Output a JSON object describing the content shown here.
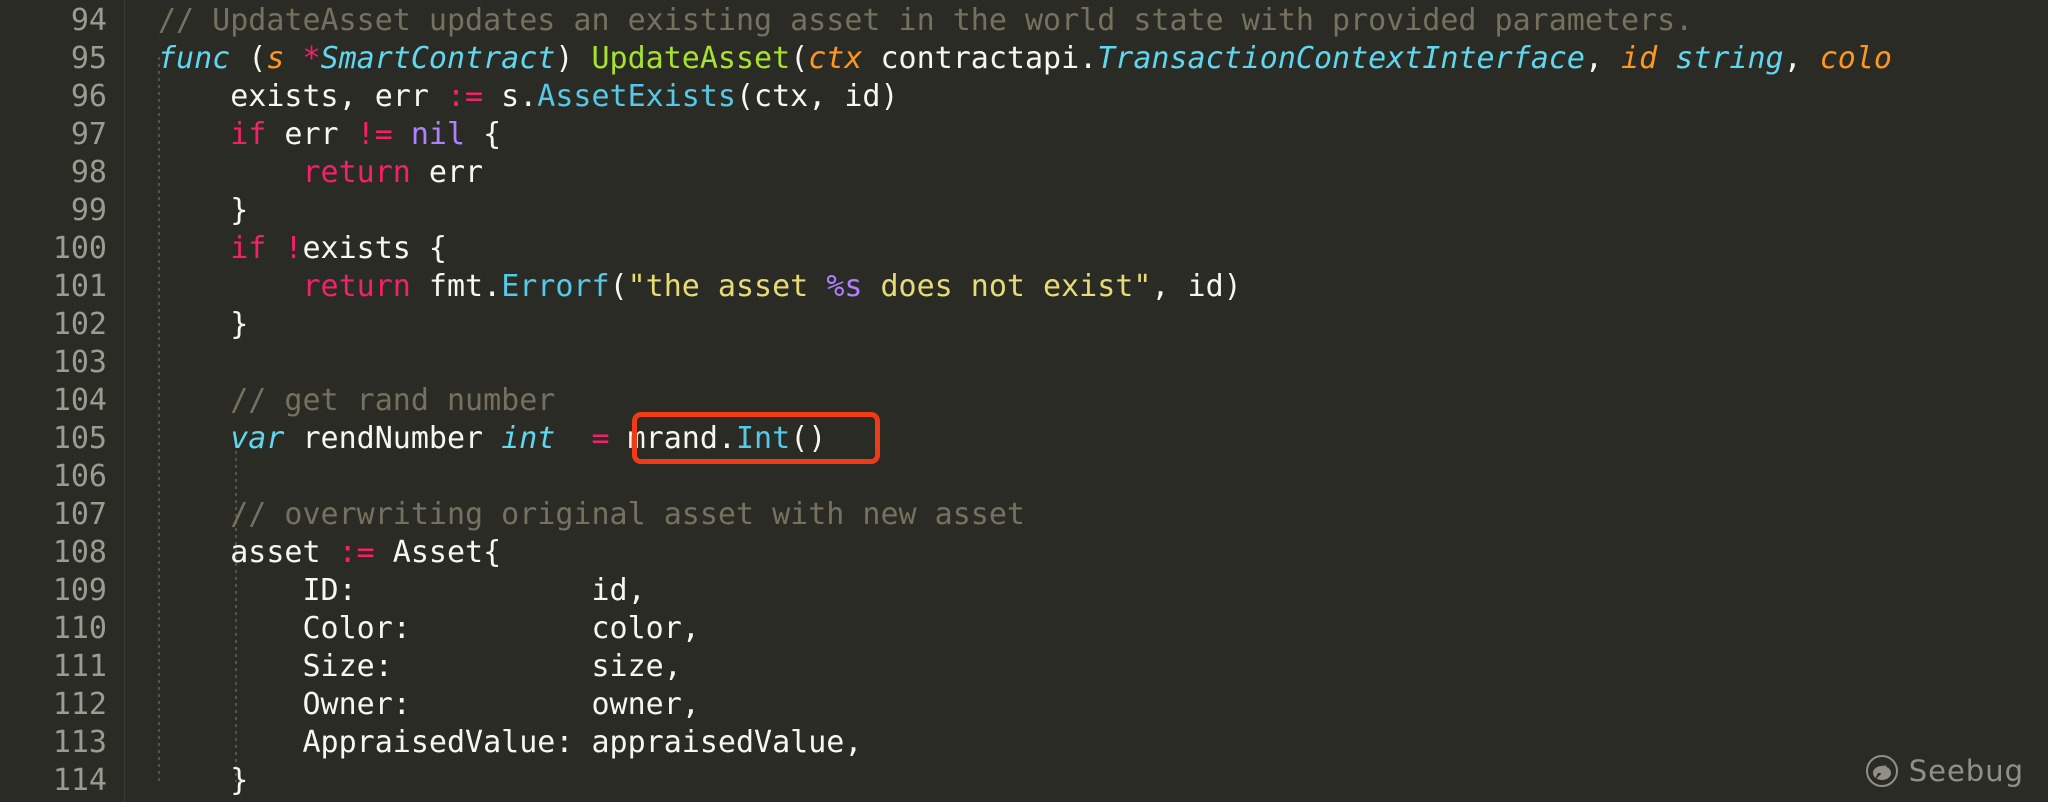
{
  "editor": {
    "language": "Go",
    "theme_background": "#2b2b25",
    "gutter_text_color": "#9b9b90",
    "first_line_number": 94,
    "last_line_number": 114
  },
  "highlight": {
    "label": "mrand.Int()",
    "border_color": "#f03c16",
    "target_line": 105
  },
  "watermark": {
    "text": "Seebug",
    "icon": "bug-circle-icon"
  },
  "lines": [
    {
      "number": "94",
      "tokens": [
        {
          "t": "// UpdateAsset updates an existing asset in the world state with provided parameters.",
          "c": "t-com"
        }
      ]
    },
    {
      "number": "95",
      "tokens": [
        {
          "t": "func",
          "c": "t-kwc"
        },
        {
          "t": " (",
          "c": "t-plain"
        },
        {
          "t": "s",
          "c": "t-par"
        },
        {
          "t": " ",
          "c": "t-plain"
        },
        {
          "t": "*",
          "c": "t-star"
        },
        {
          "t": "SmartContract",
          "c": "t-typ"
        },
        {
          "t": ") ",
          "c": "t-plain"
        },
        {
          "t": "UpdateAsset",
          "c": "t-fn"
        },
        {
          "t": "(",
          "c": "t-plain"
        },
        {
          "t": "ctx",
          "c": "t-par"
        },
        {
          "t": " contractapi.",
          "c": "t-plain"
        },
        {
          "t": "TransactionContextInterface",
          "c": "t-typ"
        },
        {
          "t": ", ",
          "c": "t-plain"
        },
        {
          "t": "id",
          "c": "t-par"
        },
        {
          "t": " ",
          "c": "t-plain"
        },
        {
          "t": "string",
          "c": "t-typ"
        },
        {
          "t": ", ",
          "c": "t-plain"
        },
        {
          "t": "colo",
          "c": "t-par"
        }
      ]
    },
    {
      "number": "96",
      "tokens": [
        {
          "t": "    exists, err ",
          "c": "t-plain"
        },
        {
          "t": ":=",
          "c": "t-op"
        },
        {
          "t": " s.",
          "c": "t-plain"
        },
        {
          "t": "AssetExists",
          "c": "t-meth"
        },
        {
          "t": "(ctx, id)",
          "c": "t-plain"
        }
      ]
    },
    {
      "number": "97",
      "tokens": [
        {
          "t": "    ",
          "c": "t-plain"
        },
        {
          "t": "if",
          "c": "t-kw"
        },
        {
          "t": " err ",
          "c": "t-plain"
        },
        {
          "t": "!=",
          "c": "t-op"
        },
        {
          "t": " ",
          "c": "t-plain"
        },
        {
          "t": "nil",
          "c": "t-num"
        },
        {
          "t": " {",
          "c": "t-plain"
        }
      ]
    },
    {
      "number": "98",
      "tokens": [
        {
          "t": "        ",
          "c": "t-plain"
        },
        {
          "t": "return",
          "c": "t-kw"
        },
        {
          "t": " err",
          "c": "t-plain"
        }
      ]
    },
    {
      "number": "99",
      "tokens": [
        {
          "t": "    }",
          "c": "t-plain"
        }
      ]
    },
    {
      "number": "100",
      "tokens": [
        {
          "t": "    ",
          "c": "t-plain"
        },
        {
          "t": "if",
          "c": "t-kw"
        },
        {
          "t": " ",
          "c": "t-plain"
        },
        {
          "t": "!",
          "c": "t-op"
        },
        {
          "t": "exists {",
          "c": "t-plain"
        }
      ]
    },
    {
      "number": "101",
      "tokens": [
        {
          "t": "        ",
          "c": "t-plain"
        },
        {
          "t": "return",
          "c": "t-kw"
        },
        {
          "t": " fmt.",
          "c": "t-plain"
        },
        {
          "t": "Errorf",
          "c": "t-meth"
        },
        {
          "t": "(",
          "c": "t-plain"
        },
        {
          "t": "\"the asset ",
          "c": "t-str"
        },
        {
          "t": "%s",
          "c": "t-fmt"
        },
        {
          "t": " does not exist\"",
          "c": "t-str"
        },
        {
          "t": ", id)",
          "c": "t-plain"
        }
      ]
    },
    {
      "number": "102",
      "tokens": [
        {
          "t": "    }",
          "c": "t-plain"
        }
      ]
    },
    {
      "number": "103",
      "tokens": []
    },
    {
      "number": "104",
      "tokens": [
        {
          "t": "    ",
          "c": "t-plain"
        },
        {
          "t": "// get rand number",
          "c": "t-com"
        }
      ]
    },
    {
      "number": "105",
      "tokens": [
        {
          "t": "    ",
          "c": "t-plain"
        },
        {
          "t": "var",
          "c": "t-kwc"
        },
        {
          "t": " rendNumber ",
          "c": "t-plain"
        },
        {
          "t": "int",
          "c": "t-typ"
        },
        {
          "t": "  ",
          "c": "t-plain"
        },
        {
          "t": "=",
          "c": "t-op"
        },
        {
          "t": " mrand.",
          "c": "t-plain"
        },
        {
          "t": "Int",
          "c": "t-meth"
        },
        {
          "t": "()",
          "c": "t-plain"
        }
      ]
    },
    {
      "number": "106",
      "tokens": []
    },
    {
      "number": "107",
      "tokens": [
        {
          "t": "    ",
          "c": "t-plain"
        },
        {
          "t": "// overwriting original asset with new asset",
          "c": "t-com"
        }
      ]
    },
    {
      "number": "108",
      "tokens": [
        {
          "t": "    asset ",
          "c": "t-plain"
        },
        {
          "t": ":=",
          "c": "t-op"
        },
        {
          "t": " Asset{",
          "c": "t-plain"
        }
      ]
    },
    {
      "number": "109",
      "tokens": [
        {
          "t": "        ID:             id,",
          "c": "t-plain"
        }
      ]
    },
    {
      "number": "110",
      "tokens": [
        {
          "t": "        Color:          color,",
          "c": "t-plain"
        }
      ]
    },
    {
      "number": "111",
      "tokens": [
        {
          "t": "        Size:           size,",
          "c": "t-plain"
        }
      ]
    },
    {
      "number": "112",
      "tokens": [
        {
          "t": "        Owner:          owner,",
          "c": "t-plain"
        }
      ]
    },
    {
      "number": "113",
      "tokens": [
        {
          "t": "        AppraisedValue: appraisedValue,",
          "c": "t-plain"
        }
      ]
    },
    {
      "number": "114",
      "tokens": [
        {
          "t": "    }",
          "c": "t-plain"
        }
      ]
    }
  ]
}
